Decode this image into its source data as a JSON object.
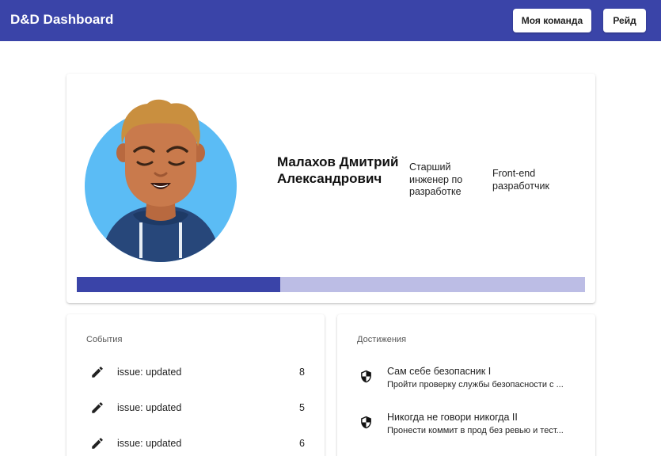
{
  "header": {
    "title": "D&D Dashboard",
    "team_button": "Моя команда",
    "raid_button": "Рейд",
    "color": "#3a44a8"
  },
  "profile": {
    "name": "Малахов Дмитрий Александрович",
    "position": "Старший инженер по разработке",
    "role": "Front-end разработчик",
    "progress_fraction": 0.4,
    "progress_color": "#3a44a8",
    "progress_track_color": "#bcbde5"
  },
  "events": {
    "title": "События",
    "icon": "pencil-icon",
    "items": [
      {
        "label": "issue: updated",
        "count": "8"
      },
      {
        "label": "issue: updated",
        "count": "5"
      },
      {
        "label": "issue: updated",
        "count": "6"
      }
    ]
  },
  "achievements": {
    "title": "Достижения",
    "icon": "shield-icon",
    "items": [
      {
        "title": "Сам себе безопасник I",
        "description": "Пройти проверку службы безопасности с ..."
      },
      {
        "title": "Никогда не говори никогда II",
        "description": "Пронести коммит в прод без ревью и тест..."
      }
    ]
  }
}
